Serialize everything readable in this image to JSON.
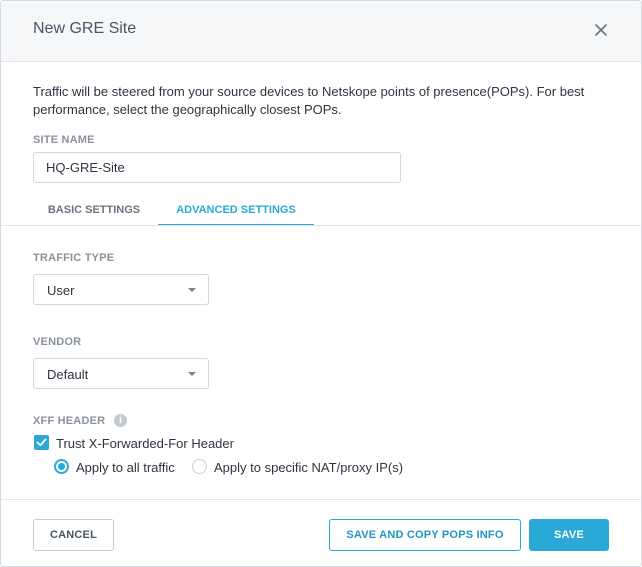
{
  "dialog": {
    "title": "New GRE Site",
    "close_icon": "close-icon",
    "description": "Traffic will be steered from your source devices to Netskope points of presence(POPs). For best performance, select the geographically closest POPs."
  },
  "site_name": {
    "label": "SITE NAME",
    "value": "HQ-GRE-Site"
  },
  "tabs": [
    {
      "label": "BASIC SETTINGS",
      "active": false
    },
    {
      "label": "ADVANCED SETTINGS",
      "active": true
    }
  ],
  "traffic_type": {
    "label": "TRAFFIC TYPE",
    "selected": "User"
  },
  "vendor": {
    "label": "VENDOR",
    "selected": "Default"
  },
  "xff": {
    "label": "XFF HEADER",
    "info_icon": "info-icon",
    "checkbox_label": "Trust X-Forwarded-For Header",
    "checked": true,
    "options": [
      {
        "label": "Apply to all traffic",
        "selected": true
      },
      {
        "label": "Apply to specific NAT/proxy IP(s)",
        "selected": false
      }
    ]
  },
  "footer": {
    "cancel_label": "CANCEL",
    "copy_label": "SAVE AND COPY POPS INFO",
    "save_label": "SAVE"
  },
  "colors": {
    "accent": "#2aa9d6",
    "header_bg": "#f6f7f8",
    "muted_label": "#8a929c"
  }
}
